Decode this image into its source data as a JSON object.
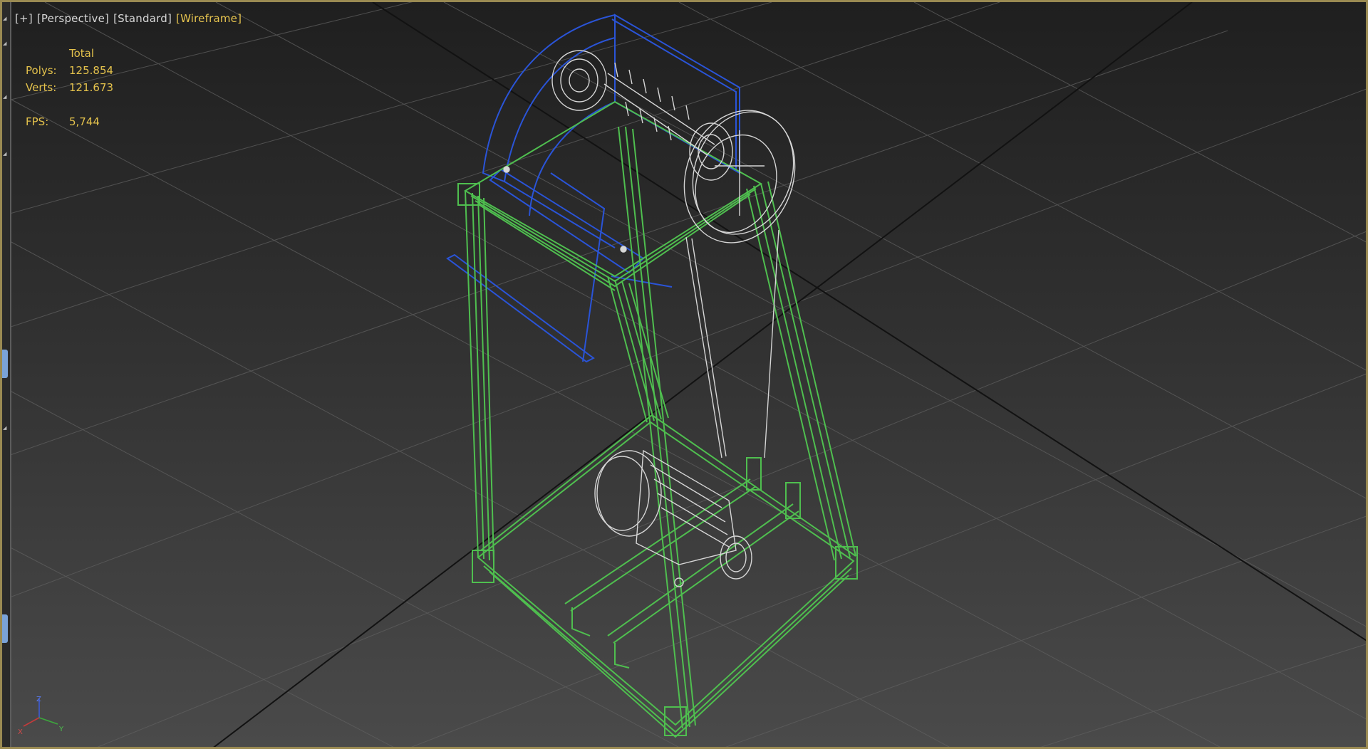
{
  "viewport": {
    "labels": [
      "[+]",
      "[Perspective]",
      "[Standard]",
      "[Wireframe]"
    ],
    "active_label_index": 3
  },
  "stats": {
    "header": "Total",
    "polys_label": "Polys:",
    "polys_value": "125.854",
    "verts_label": "Verts:",
    "verts_value": "121.673",
    "fps_label": "FPS:",
    "fps_value": "5,744"
  },
  "axis_gizmo": {
    "z": "Z",
    "y": "Y",
    "x": "X"
  },
  "colors": {
    "frame": "#4fbf4f",
    "blue_guard": "#2a54d8",
    "mesh": "#d6d6d6",
    "grid": "#5f5f5f",
    "grid_major": "#121212",
    "label_active": "#e6c44f",
    "stats": "#e4c24c",
    "border": "#9a8a52"
  }
}
